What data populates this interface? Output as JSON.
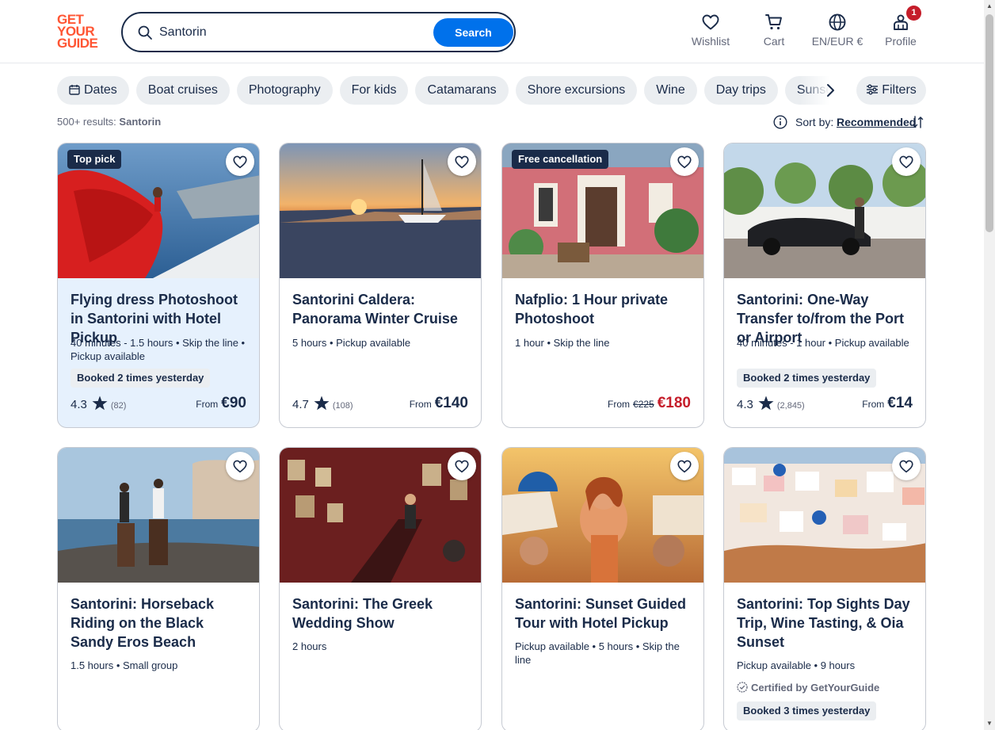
{
  "header": {
    "logo": [
      "GET",
      "YOUR",
      "GUIDE"
    ],
    "search_value": "Santorin",
    "search_button": "Search",
    "wishlist": "Wishlist",
    "cart": "Cart",
    "language": "EN/EUR €",
    "profile": "Profile",
    "profile_badge": "1"
  },
  "chips": [
    "Dates",
    "Boat cruises",
    "Photography",
    "For kids",
    "Catamarans",
    "Shore excursions",
    "Wine",
    "Day trips",
    "Sunset"
  ],
  "filters_label": "Filters",
  "results": {
    "count": "500+ results:",
    "query": "Santorin"
  },
  "sort": {
    "label": "Sort by:",
    "value": "Recommended"
  },
  "cards": [
    {
      "badge": "Top pick",
      "title": "Flying dress Photoshoot in Santorini with Hotel Pickup",
      "meta": "40 minutes - 1.5 hours • Skip the line • Pickup available",
      "booked": "Booked 2 times yesterday",
      "rating": "4.3",
      "reviews": "(82)",
      "from": "From",
      "old_price": "",
      "price": "€90"
    },
    {
      "badge": "",
      "title": "Santorini Caldera: Panorama Winter Cruise",
      "meta": "5 hours • Pickup available",
      "booked": "",
      "rating": "4.7",
      "reviews": "(108)",
      "from": "From",
      "old_price": "",
      "price": "€140"
    },
    {
      "badge": "Free cancellation",
      "title": "Nafplio: 1 Hour private Photoshoot",
      "meta": "1 hour • Skip the line",
      "booked": "",
      "rating": "",
      "reviews": "",
      "from": "From",
      "old_price": "€225",
      "price": "€180"
    },
    {
      "badge": "",
      "title": "Santorini: One-Way Transfer to/from the Port or Airport",
      "meta": "40 minutes - 1 hour • Pickup available",
      "booked": "Booked 2 times yesterday",
      "rating": "4.3",
      "reviews": "(2,845)",
      "from": "From",
      "old_price": "",
      "price": "€14"
    },
    {
      "title": "Santorini: Horseback Riding on the Black Sandy Eros Beach",
      "meta": "1.5 hours • Small group"
    },
    {
      "title": "Santorini: The Greek Wedding Show",
      "meta": "2 hours"
    },
    {
      "title": "Santorini: Sunset Guided Tour with Hotel Pickup",
      "meta": "Pickup available • 5 hours • Skip the line"
    },
    {
      "title": "Santorini: Top Sights Day Trip, Wine Tasting, & Oia Sunset",
      "meta": "Pickup available • 9 hours",
      "certified": "Certified by GetYourGuide",
      "booked": "Booked 3 times yesterday"
    }
  ],
  "colors": {
    "brand": "#ff5533",
    "primary": "#0071eb",
    "text": "#1a2b49",
    "sale": "#c51d2a",
    "highlight": "#e6f1fd"
  }
}
